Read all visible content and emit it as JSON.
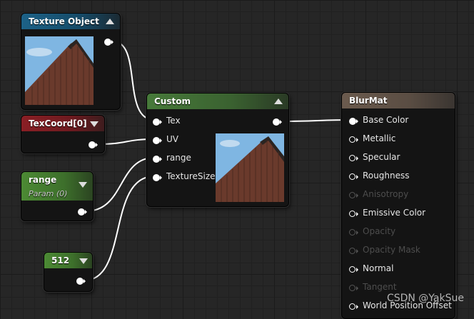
{
  "nodes": {
    "texture_object": {
      "title": "Texture Object"
    },
    "texcoord": {
      "title": "TexCoord[0]"
    },
    "range": {
      "title": "range",
      "subtitle": "Param (0)"
    },
    "constant": {
      "title": "512"
    },
    "custom": {
      "title": "Custom",
      "inputs": [
        "Tex",
        "UV",
        "range",
        "TextureSize"
      ]
    },
    "material": {
      "title": "BlurMat",
      "inputs": [
        {
          "label": "Base Color",
          "enabled": true
        },
        {
          "label": "Metallic",
          "enabled": true
        },
        {
          "label": "Specular",
          "enabled": true
        },
        {
          "label": "Roughness",
          "enabled": true
        },
        {
          "label": "Anisotropy",
          "enabled": false
        },
        {
          "label": "Emissive Color",
          "enabled": true
        },
        {
          "label": "Opacity",
          "enabled": false
        },
        {
          "label": "Opacity Mask",
          "enabled": false
        },
        {
          "label": "Normal",
          "enabled": true
        },
        {
          "label": "Tangent",
          "enabled": false
        },
        {
          "label": "World Position Offset",
          "enabled": true
        }
      ]
    }
  },
  "colors": {
    "texture_header": "#1d6288",
    "custom_header": "#477a3a",
    "texcoord_header": "#8a1f25",
    "range_header": "#4c8a34",
    "material_header": "#6b5b4e",
    "wire": "#ffffff"
  },
  "watermark": "CSDN @YakSue"
}
